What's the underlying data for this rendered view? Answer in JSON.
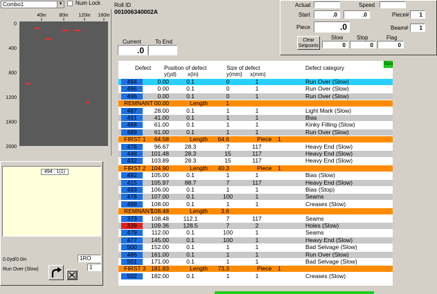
{
  "top": {
    "combo_value": "Combo1",
    "num_lock_label": "Num Lock"
  },
  "map": {
    "x_ticks": [
      "40in",
      "80in",
      "120in",
      "160in"
    ],
    "y_ticks": [
      "0",
      "400",
      "800",
      "1200",
      "1600",
      "2000"
    ],
    "colors": {
      "background": "#5a5a5a",
      "defect": "#ff2a2a",
      "tick": "#333333"
    }
  },
  "roll": {
    "id_label": "Roll ID",
    "id_value": "001006340002A"
  },
  "current": {
    "label": "Current",
    "value": ".0",
    "to_end_label": "To End",
    "to_end_value": ""
  },
  "info": {
    "box_label": "494 : 1(1)",
    "footage": "0.0yd/0.0in",
    "category": "Run Over (Slow)",
    "code_value": "1RO",
    "count_value": "1",
    "jump_icon": "curved-arrow-icon",
    "close_icon": "x-icon"
  },
  "setpoints": {
    "actual_label": "Actual",
    "actual_value": "",
    "speed_label": "Speed",
    "speed_value": "",
    "start_label": "Start",
    "start_value": ".0",
    "start_value2": ".0",
    "piece_num_label": "Piece#",
    "piece_num_value": "1",
    "piece_label": "Piece",
    "piece_value": ".0",
    "beam_label": "Beam#",
    "beam_value": "1",
    "clear_button": "Clear Setpoints",
    "slow_label": "Slow",
    "slow_value": "0",
    "stop_label": "Stop",
    "stop_value": "0",
    "flag_label": "Flag",
    "flag_value": "0"
  },
  "scroll_button": "Scroll",
  "table": {
    "h_defect": "Defect",
    "h_position": "Position of defect",
    "h_size": "Size of defect",
    "h_category": "Defect category",
    "h_y": "y(yd)",
    "h_x": "x(in)",
    "h_sy": "y(mm)",
    "h_sx": "x(mm)",
    "length_label": "Length",
    "piece_label": "Piece",
    "rows": [
      {
        "t": "d",
        "id": "494",
        "y": "0.00",
        "x": "0.1",
        "sy": "0",
        "sx": "1",
        "cat": "Run Over (Slow)",
        "idc": "#1e6fe0",
        "bg": "#29d0ff"
      },
      {
        "t": "d",
        "id": "495",
        "y": "0.00",
        "x": "0.1",
        "sy": "0",
        "sx": "1",
        "cat": "Run Over (Slow)",
        "idc": "#1e6fe0",
        "bg": "#ffffff"
      },
      {
        "t": "d",
        "id": "496",
        "y": "0.00",
        "x": "0.1",
        "sy": "0",
        "sx": "1",
        "cat": "Run Over (Slow)",
        "idc": "#1e6fe0",
        "bg": "#c8c8c8"
      },
      {
        "t": "s",
        "label": "REMNANT",
        "pos": "00.00",
        "len": "1",
        "piece": ""
      },
      {
        "t": "d",
        "id": "487",
        "y": "28.00",
        "x": "0.1",
        "sy": "1",
        "sx": "1",
        "cat": "Light Mark (Slow)",
        "idc": "#1e6fe0",
        "bg": "#ffffff"
      },
      {
        "t": "d",
        "id": "491",
        "y": "41.00",
        "x": "0.1",
        "sy": "1",
        "sx": "1",
        "cat": "Bias",
        "idc": "#1e6fe0",
        "bg": "#c8c8c8"
      },
      {
        "t": "d",
        "id": "488",
        "y": "61.00",
        "x": "0.1",
        "sy": "1",
        "sx": "1",
        "cat": "Kinky Filling (Slow)",
        "idc": "#1e6fe0",
        "bg": "#ffffff"
      },
      {
        "t": "d",
        "id": "489",
        "y": "61.00",
        "x": "0.1",
        "sy": "1",
        "sx": "1",
        "cat": "Run Over (Slow)",
        "idc": "#1e6fe0",
        "bg": "#c8c8c8"
      },
      {
        "t": "s",
        "label": "FIRST 1",
        "pos": "64.58",
        "len": "64.6",
        "piece": "1"
      },
      {
        "t": "d",
        "id": "476",
        "y": "96.67",
        "x": "28.3",
        "sy": "7",
        "sx": "117",
        "cat": "Heavy End (Slow)",
        "idc": "#1e6fe0",
        "bg": "#ffffff"
      },
      {
        "t": "d",
        "id": "448",
        "y": "101.48",
        "x": "28.3",
        "sy": "15",
        "sx": "117",
        "cat": "Heavy End (Slow)",
        "idc": "#1e6fe0",
        "bg": "#c8c8c8"
      },
      {
        "t": "d",
        "id": "432",
        "y": "103.89",
        "x": "28.3",
        "sy": "15",
        "sx": "117",
        "cat": "Heavy End (Slow)",
        "idc": "#1e6fe0",
        "bg": "#ffffff"
      },
      {
        "t": "s",
        "label": "FIRST 2",
        "pos": "104.90",
        "len": "40.3",
        "piece": "1"
      },
      {
        "t": "d",
        "id": "492",
        "y": "105.00",
        "x": "0.1",
        "sy": "1",
        "sx": "1",
        "cat": "Bias (Slow)",
        "idc": "#1e6fe0",
        "bg": "#ffffff"
      },
      {
        "t": "d",
        "id": "415",
        "y": "105.97",
        "x": "88.7",
        "sy": "7",
        "sx": "117",
        "cat": "Heavy End (Slow)",
        "idc": "#1e6fe0",
        "bg": "#c8c8c8"
      },
      {
        "t": "d",
        "id": "493",
        "y": "106.00",
        "x": "0.1",
        "sy": "1",
        "sx": "1",
        "cat": "Bias (Stop)",
        "idc": "#1e6fe0",
        "bg": "#ffffff"
      },
      {
        "t": "d",
        "id": "478",
        "y": "107.00",
        "x": "0.1",
        "sy": "100",
        "sx": "1",
        "cat": "Seams",
        "idc": "#1e6fe0",
        "bg": "#c8c8c8"
      },
      {
        "t": "d",
        "id": "499",
        "y": "108.00",
        "x": "0.1",
        "sy": "1",
        "sx": "1",
        "cat": "Creases (Slow)",
        "idc": "#1e6fe0",
        "bg": "#ffffff"
      },
      {
        "t": "s",
        "label": "REMNANT",
        "pos": "108.48",
        "len": "3.6",
        "piece": ""
      },
      {
        "t": "d",
        "id": "373",
        "y": "108.48",
        "x": "112.1",
        "sy": "7",
        "sx": "117",
        "cat": "Seams",
        "idc": "#1e6fe0",
        "bg": "#ffffff"
      },
      {
        "t": "d",
        "id": "339",
        "y": "109.36",
        "x": "128.5",
        "sy": "7",
        "sx": "2",
        "cat": "Holes (Slow)",
        "idc": "#e02020",
        "bg": "#c8c8c8"
      },
      {
        "t": "d",
        "id": "479",
        "y": "112.00",
        "x": "0.1",
        "sy": "100",
        "sx": "1",
        "cat": "Seams",
        "idc": "#1e6fe0",
        "bg": "#ffffff"
      },
      {
        "t": "d",
        "id": "477",
        "y": "145.00",
        "x": "0.1",
        "sy": "100",
        "sx": "1",
        "cat": "Heavy End (Slow)",
        "idc": "#1e6fe0",
        "bg": "#c8c8c8"
      },
      {
        "t": "d",
        "id": "500",
        "y": "152.00",
        "x": "0.1",
        "sy": "1",
        "sx": "1",
        "cat": "Bad Selvage (Slow)",
        "idc": "#1e6fe0",
        "bg": "#ffffff"
      },
      {
        "t": "d",
        "id": "486",
        "y": "161.00",
        "x": "0.1",
        "sy": "1",
        "sx": "1",
        "cat": "Run Over (Slow)",
        "idc": "#1e6fe0",
        "bg": "#c8c8c8"
      },
      {
        "t": "d",
        "id": "501",
        "y": "171.00",
        "x": "0.1",
        "sy": "1",
        "sx": "1",
        "cat": "Bad Selvage (Slow)",
        "idc": "#1e6fe0",
        "bg": "#ffffff"
      },
      {
        "t": "s",
        "label": "FIRST 3",
        "pos": "181.83",
        "len": "73.3",
        "piece": "1"
      },
      {
        "t": "d",
        "id": "502",
        "y": "182.00",
        "x": "0.1",
        "sy": "1",
        "sx": "1",
        "cat": "Creases (Slow)",
        "idc": "#1e6fe0",
        "bg": "#ffffff"
      }
    ]
  },
  "colors": {
    "segment": "#ff8c00",
    "scroll_button": "#19d619"
  }
}
